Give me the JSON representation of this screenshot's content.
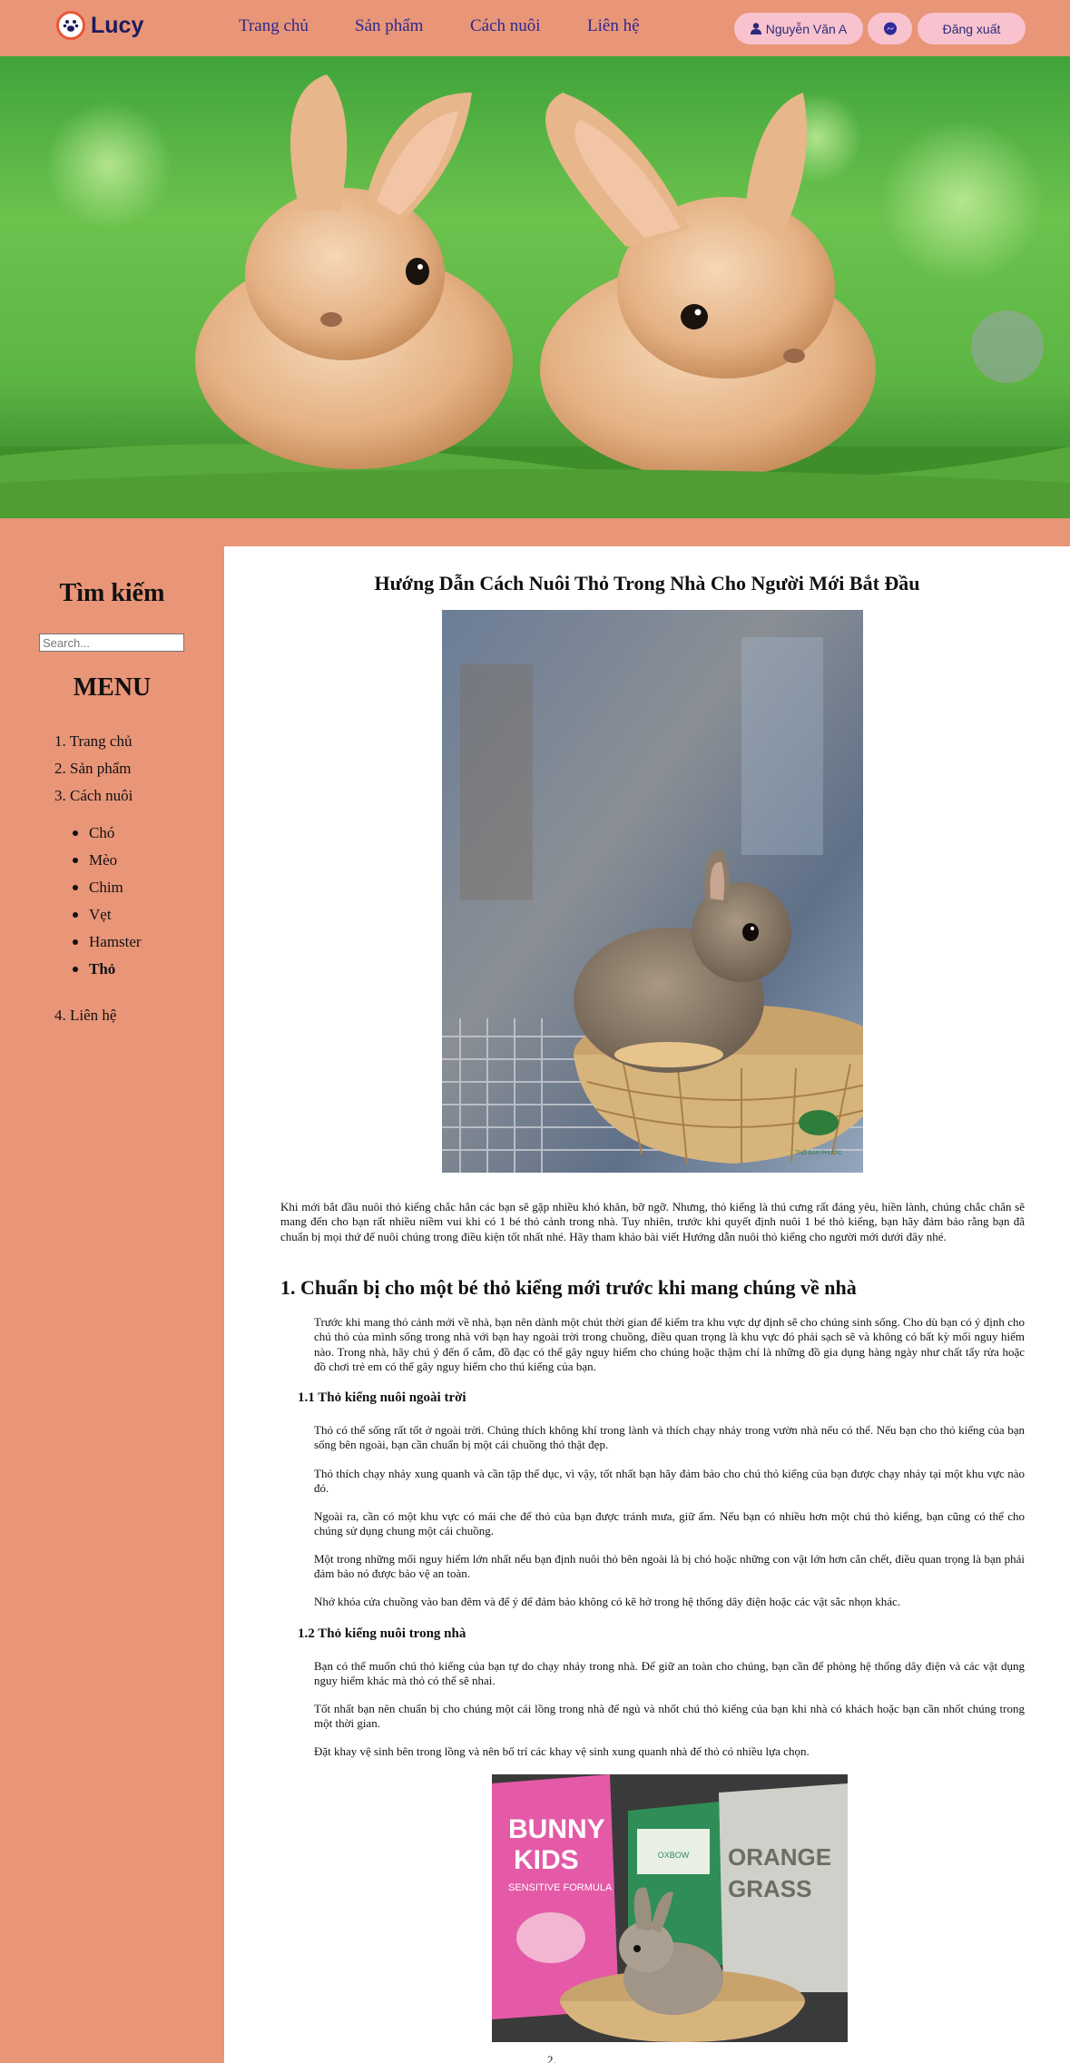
{
  "brand": {
    "name": "Lucy"
  },
  "nav": {
    "links": [
      "Trang chủ",
      "Sản phẩm",
      "Cách nuôi",
      "Liên hệ"
    ],
    "user_name": "Nguyễn Văn A",
    "logout": "Đăng xuất"
  },
  "sidebar": {
    "search_title": "Tìm kiếm",
    "search_placeholder": "Search...",
    "menu_title": "MENU",
    "menu": [
      "1. Trang chủ",
      "2. Sản phẩm",
      "3. Cách nuôi",
      "4. Liên hệ"
    ],
    "submenu": [
      "Chó",
      "Mèo",
      "Chim",
      "Vẹt",
      "Hamster",
      "Thỏ"
    ]
  },
  "article": {
    "title": "Hướng Dẫn Cách Nuôi Thỏ Trong Nhà Cho Người Mới Bắt Đầu",
    "intro": "Khi mới bắt đầu nuôi thỏ kiểng chắc hẳn các bạn sẽ gặp nhiều khó khăn, bỡ ngỡ. Nhưng, thỏ kiểng là thú cưng rất đáng yêu, hiền lành, chúng chắc chắn sẽ mang đến cho bạn rất nhiều niềm vui khi có 1 bé thỏ cảnh trong nhà. Tuy nhiên, trước khi quyết định nuôi 1 bé thỏ kiểng, bạn hãy đảm bảo rằng bạn đã chuẩn bị mọi thứ để nuôi chúng trong điều kiện tốt nhất nhé. Hãy tham khảo bài viết Hướng dẫn nuôi thỏ kiểng cho người mới dưới đây nhé.",
    "section1_title": "1. Chuẩn bị cho một bé thỏ kiểng mới trước khi mang chúng về nhà",
    "section1_para": "Trước khi mang thỏ cảnh mới về nhà, bạn nên dành một chút thời gian để kiểm tra khu vực dự định sẽ cho chúng sinh sống. Cho dù bạn có ý định cho chú thỏ của mình sống trong nhà với bạn hay ngoài trời trong chuồng, điều quan trọng là khu vực đó phải sạch sẽ và không có bất kỳ mối nguy hiểm nào. Trong nhà, hãy chú ý đến ổ cắm, đồ đạc có thể gây nguy hiểm cho chúng hoặc thậm chí là những đồ gia dụng hàng ngày như chất tẩy rửa hoặc đồ chơi trẻ em có thể gây nguy hiểm cho thú kiểng của bạn.",
    "sub1_title": "1.1 Thỏ kiểng nuôi ngoài trời",
    "sub1_paras": [
      "Thỏ có thể sống rất tốt ở ngoài trời. Chúng thích không khí trong lành và thích chạy nhảy trong vườn nhà nếu có thể. Nếu bạn cho thỏ kiểng của bạn sống bên ngoài, bạn cần chuẩn bị một cái chuồng thỏ thật đẹp.",
      "Thỏ thích chạy nhảy xung quanh và cần tập thể dục, vì vậy, tốt nhất bạn hãy đảm bảo cho chú thỏ kiểng của bạn được chạy nhảy tại một khu vực nào đó.",
      "Ngoài ra, cần có một khu vực có mái che để thỏ của bạn được tránh mưa, giữ ấm. Nếu bạn có nhiều hơn một chú thỏ kiểng, bạn cũng có thể cho chúng sử dụng chung một cái chuồng.",
      "Một trong những mối nguy hiểm lớn nhất nếu bạn định nuôi thỏ bên ngoài là bị chó hoặc những con vật lớn hơn cắn chết, điều quan trọng là bạn phải đảm bảo nó được bảo vệ an toàn.",
      "Nhớ khóa cửa chuồng vào ban đêm và để ý để đảm bảo không có kẽ hở trong hệ thống dây điện hoặc các vật sắc nhọn khác."
    ],
    "sub2_title": "1.2 Thỏ kiểng nuôi trong nhà",
    "sub2_paras": [
      "Bạn có thể muốn chú thỏ kiểng của bạn tự do chạy nhảy trong nhà. Để giữ an toàn cho chúng, bạn cần để phòng hệ thống dây điện và các vật dụng nguy hiểm khác mà thỏ có thể sẽ nhai.",
      "Tốt nhất bạn nên chuẩn bị cho chúng một cái lồng trong nhà để ngủ và nhốt chú thỏ kiểng của bạn khi nhà có khách hoặc bạn cần nhốt chúng trong một thời gian.",
      "Đặt khay vệ sinh bên trong lồng và nên bố trí các khay vệ sinh xung quanh nhà để thỏ có nhiều lựa chọn."
    ],
    "img1_brand": "THỎ BAN PHƯỚC",
    "img2_labels": [
      "BUNNY",
      "KIDS",
      "SENSITIVE FORMULA",
      "ORANGE",
      "GRASS",
      "OXBOW"
    ],
    "caption_fragment": "2."
  }
}
